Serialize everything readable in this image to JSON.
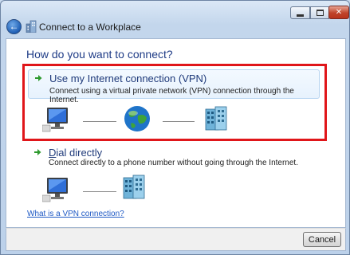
{
  "window": {
    "title": "Connect to a Workplace",
    "back_icon": "back-arrow-icon",
    "app_icon": "workplace-building-icon",
    "controls": [
      "minimize",
      "maximize",
      "close"
    ]
  },
  "main": {
    "heading": "How do you want to connect?",
    "options": [
      {
        "title": "Use my Internet connection (VPN)",
        "description": "Connect using a virtual private network (VPN) connection through the Internet.",
        "icons": [
          "computer-icon",
          "globe-icon",
          "server-icon"
        ],
        "selected": true
      },
      {
        "title": "Dial directly",
        "accelerator": "D",
        "description": "Connect directly to a phone number without going through the Internet.",
        "icons": [
          "computer-icon",
          "server-icon"
        ]
      }
    ],
    "help_link": "What is a VPN connection?"
  },
  "footer": {
    "cancel_label": "Cancel"
  },
  "colors": {
    "highlight": "#e0161a",
    "heading": "#1e3b86",
    "link": "#1d58c4",
    "arrow": "#2e9a2e"
  }
}
